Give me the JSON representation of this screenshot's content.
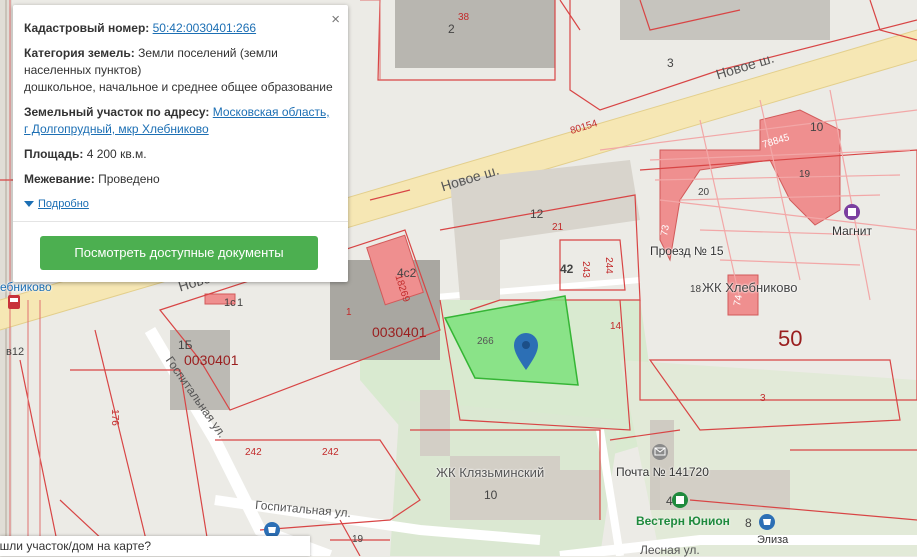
{
  "popup": {
    "cadastral_label": "Кадастровый номер:",
    "cadastral_value": "50:42:0030401:266",
    "category_label": "Категория земель:",
    "category_value": "Земли поселений (земли населенных пунктов)",
    "category_use": "дошкольное, начальное и среднее общее образование",
    "address_label": "Земельный участок по адресу:",
    "address_value_1": "Московская область,",
    "address_value_2": "г Долгопрудный, мкр Хлебниково",
    "area_label": "Площадь:",
    "area_value": "4 200 кв.м.",
    "survey_label": "Межевание:",
    "survey_value": "Проведено",
    "more_link": "Подробно",
    "docs_button": "Посмотреть доступные документы",
    "close_glyph": "×"
  },
  "question": {
    "text": "ашли участок/дом на карте?"
  },
  "map": {
    "roads": {
      "novoe_1": "Новое ш.",
      "novoe_2": "Новое ш.",
      "novoe_3": "Ново",
      "gospital_1": "Госпитальная ул.",
      "gospital_2": "Госпитальная ул.",
      "lesnaya": "Лесная ул."
    },
    "labels": {
      "p38": "38",
      "b2": "2",
      "b3": "3",
      "p80154": "80154",
      "p78845": "78845",
      "b10": "10",
      "b20": "20",
      "b19": "19",
      "b12": "12",
      "p21": "21",
      "p18269": "18269",
      "b4c2": "4с2",
      "p1": "1",
      "b1": "1",
      "q0030401a": "0030401",
      "q0030401b": "0030401",
      "b1b": "1Б",
      "b1c": "1с",
      "p266": "266",
      "b42": "42",
      "p243": "243",
      "p244": "244",
      "p14": "14",
      "p18": "18",
      "p3": "3",
      "p176": "176",
      "p242a": "242",
      "p242b": "242",
      "b10b": "10",
      "p8": "8",
      "p4": "4",
      "p73": "73",
      "p74": "74",
      "q50": "50",
      "station": "ебниково",
      "v12": "в12",
      "mall": "Магнит",
      "passage": "Проезд № 15",
      "jk_hleb": "ЖК Хлебниково",
      "jk_klyaz": "ЖК Клязьминский",
      "post": "Почта № 141720",
      "wu": "Вестерн Юнион",
      "elisa": "Элиза",
      "b19b": "19"
    }
  }
}
